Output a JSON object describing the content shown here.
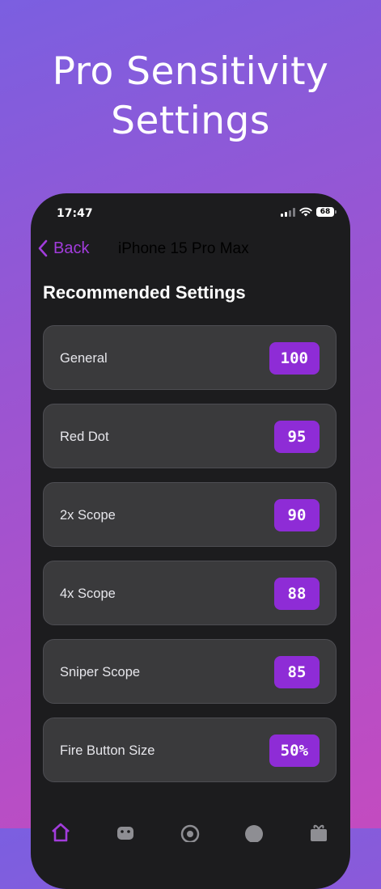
{
  "promo": {
    "title_line1": "Pro Sensitivity",
    "title_line2": "Settings"
  },
  "status_bar": {
    "time": "17:47",
    "battery": "68"
  },
  "nav": {
    "back_label": "Back",
    "title": "iPhone 15 Pro Max"
  },
  "section_title": "Recommended Settings",
  "settings": [
    {
      "label": "General",
      "value": "100"
    },
    {
      "label": "Red Dot",
      "value": "95"
    },
    {
      "label": "2x Scope",
      "value": "90"
    },
    {
      "label": "4x Scope",
      "value": "88"
    },
    {
      "label": "Sniper Scope",
      "value": "85"
    },
    {
      "label": "Fire Button Size",
      "value": "50%"
    }
  ],
  "tab_bar": {
    "icons": [
      "home-icon",
      "gamepad-icon",
      "target-icon",
      "info-icon",
      "gift-icon"
    ]
  },
  "colors": {
    "accent": "#8e2cd6",
    "back_link": "#a23cdc",
    "card_background": "#3a3a3c",
    "screen_background": "#1c1c1e"
  }
}
